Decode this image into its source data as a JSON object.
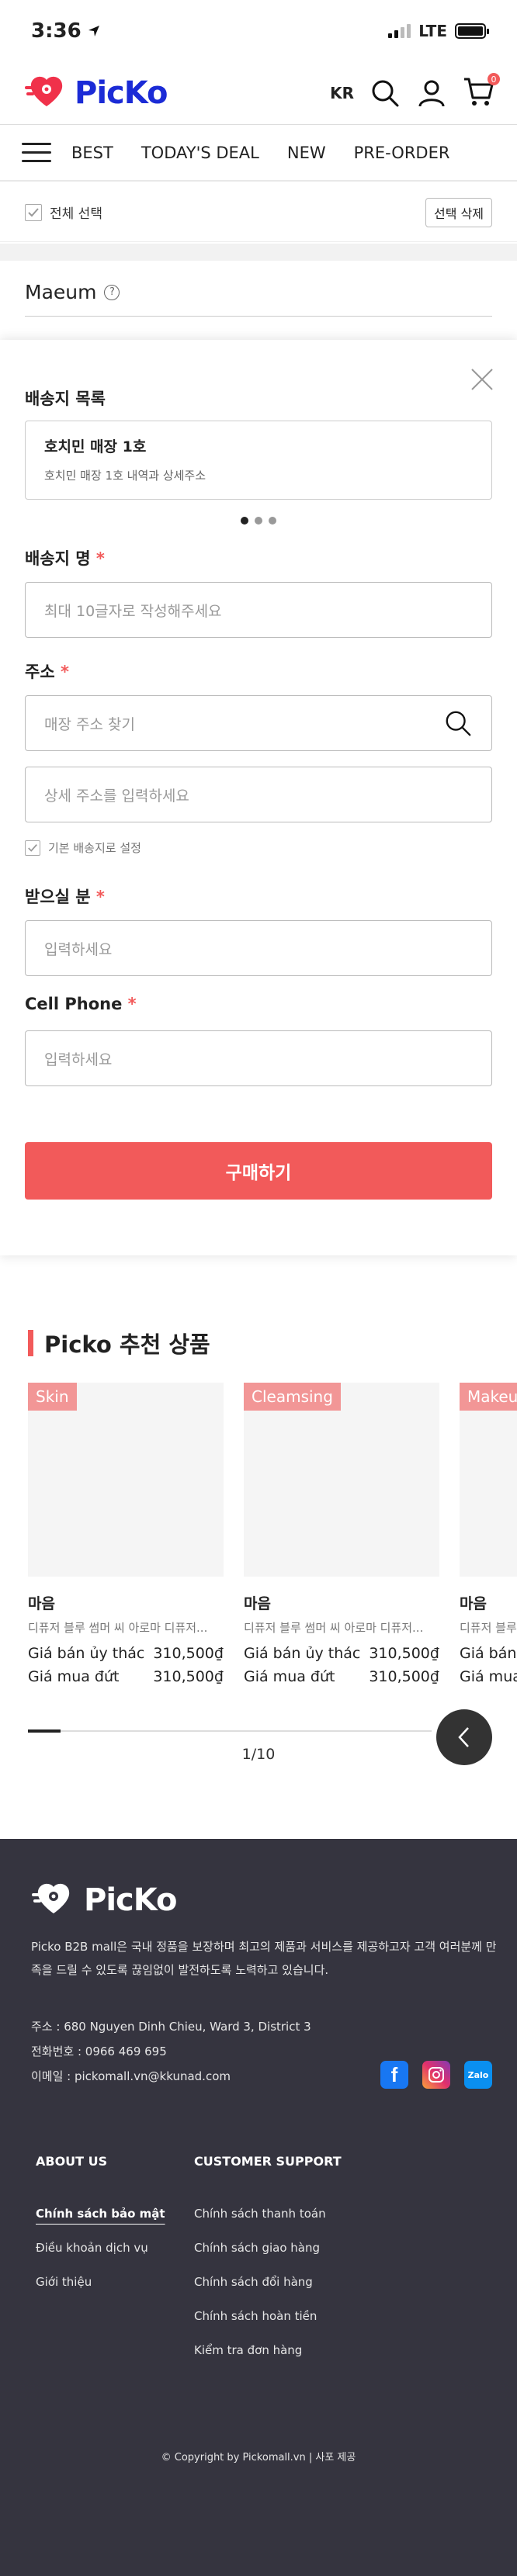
{
  "status_bar": {
    "time": "3:36",
    "network": "LTE"
  },
  "header": {
    "logo_text": "PicKo",
    "lang": "KR",
    "cart_count": "0"
  },
  "nav": {
    "items": [
      "BEST",
      "TODAY'S DEAL",
      "NEW",
      "PRE-ORDER"
    ]
  },
  "select_bar": {
    "select_all": "전체 선택",
    "delete_selected": "선택 삭제"
  },
  "brand": {
    "name": "Maeum"
  },
  "sheet": {
    "list_title": "배송지 목록",
    "address_card": {
      "name": "호치민 매장 1호",
      "detail": "호치민 매장 1호 내역과 상세주소"
    },
    "store_name_label": "배송지 명",
    "store_name_placeholder": "최대 10글자로 작성해주세요",
    "address_label": "주소",
    "address_search_placeholder": "매장 주소 찾기",
    "address_detail_placeholder": "상세 주소를 입력하세요",
    "default_label": "기본 배송지로 설정",
    "receiver_label": "받으실 분",
    "receiver_placeholder": "입력하세요",
    "phone_label": "Cell Phone",
    "phone_placeholder": "입력하세요",
    "buy_button": "구매하기",
    "required_mark": "*"
  },
  "recommend": {
    "title": "Picko 추천 상품",
    "products": [
      {
        "tag": "Skin",
        "brand": "마음",
        "name": "디퓨저 블루 썸머 씨 아로마 디퓨저...",
        "price1_label": "Giá bán ủy thác",
        "price1": "310,500₫",
        "price2_label": "Giá mua đứt",
        "price2": "310,500₫"
      },
      {
        "tag": "Cleamsing",
        "brand": "마음",
        "name": "디퓨저 블루 썸머 씨 아로마 디퓨저...",
        "price1_label": "Giá bán ủy thác",
        "price1": "310,500₫",
        "price2_label": "Giá mua đứt",
        "price2": "310,500₫"
      },
      {
        "tag": "Makeu",
        "brand": "마음",
        "name": "디퓨저 블루",
        "price1_label": "Giá bán",
        "price1": "",
        "price2_label": "Giá mua",
        "price2": ""
      }
    ],
    "pager": "1/10"
  },
  "footer": {
    "logo_text": "PicKo",
    "description": "Picko B2B mall은 국내 정품을 보장하며 최고의 제품과 서비스를 제공하고자 고객 여러분께 만족을 드릴 수 있도록 끊임없이 발전하도록 노력하고 있습니다.",
    "address": "주소 : 680 Nguyen Dinh Chieu, Ward 3, District 3",
    "phone": "전화번호 : 0966 469 695",
    "email": "이메일 : pickomall.vn@kkunad.com",
    "zalo": "Zalo",
    "about_title": "ABOUT US",
    "about_links": [
      "Chính sách bảo mật",
      "Điều khoản dịch vụ",
      "Giới thiệu"
    ],
    "support_title": "CUSTOMER SUPPORT",
    "support_links": [
      "Chính sách thanh toán",
      "Chính sách giao hàng",
      "Chính sách đổi hàng",
      "Chính sách hoàn tiền",
      "Kiểm tra đơn hàng"
    ],
    "copyright": "© Copyright by Pickomall.vn | 사포 제공"
  },
  "colors": {
    "accent": "#f25a5a",
    "brand_blue": "#1b2bd6",
    "footer_bg": "#35343f",
    "tag": "#f29696"
  }
}
